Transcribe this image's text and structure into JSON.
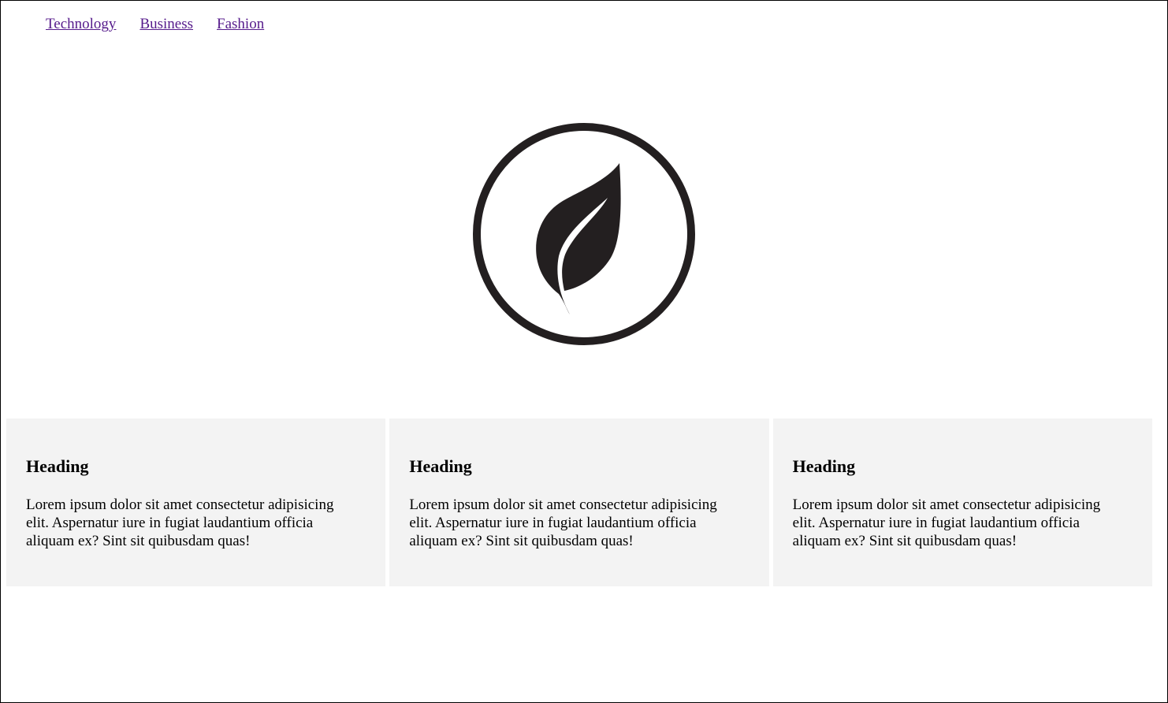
{
  "nav": {
    "items": [
      {
        "label": "Technology"
      },
      {
        "label": "Business"
      },
      {
        "label": "Fashion"
      }
    ]
  },
  "logo": {
    "icon": "leaf-in-circle-icon",
    "color": "#231f20"
  },
  "cards": [
    {
      "heading": "Heading",
      "body": "Lorem ipsum dolor sit amet consectetur adipisicing elit. Aspernatur iure in fugiat laudantium officia aliquam ex? Sint sit quibusdam quas!"
    },
    {
      "heading": "Heading",
      "body": "Lorem ipsum dolor sit amet consectetur adipisicing elit. Aspernatur iure in fugiat laudantium officia aliquam ex? Sint sit quibusdam quas!"
    },
    {
      "heading": "Heading",
      "body": "Lorem ipsum dolor sit amet consectetur adipisicing elit. Aspernatur iure in fugiat laudantium officia aliquam ex? Sint sit quibusdam quas!"
    }
  ],
  "colors": {
    "link_visited": "#551a8b",
    "card_background": "#f3f3f3"
  }
}
